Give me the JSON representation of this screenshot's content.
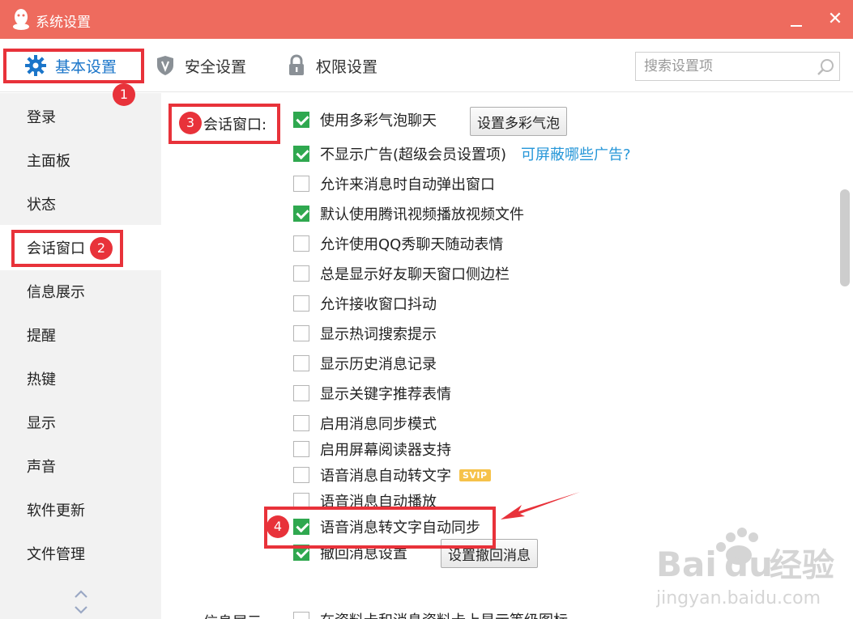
{
  "window": {
    "title": "系统设置"
  },
  "tabs": [
    {
      "label": "基本设置",
      "icon": "gear-icon"
    },
    {
      "label": "安全设置",
      "icon": "shield-icon"
    },
    {
      "label": "权限设置",
      "icon": "lock-icon"
    }
  ],
  "search": {
    "placeholder": "搜索设置项",
    "value": ""
  },
  "sidebar": {
    "items": [
      {
        "label": "登录"
      },
      {
        "label": "主面板"
      },
      {
        "label": "状态"
      },
      {
        "label": "会话窗口"
      },
      {
        "label": "信息展示"
      },
      {
        "label": "提醒"
      },
      {
        "label": "热键"
      },
      {
        "label": "显示"
      },
      {
        "label": "声音"
      },
      {
        "label": "软件更新"
      },
      {
        "label": "文件管理"
      }
    ],
    "active": "会话窗口"
  },
  "main": {
    "section_label": "会话窗口:",
    "options": [
      {
        "label": "使用多彩气泡聊天",
        "checked": true
      },
      {
        "label": "不显示广告(超级会员设置项)",
        "checked": true
      },
      {
        "label": "允许来消息时自动弹出窗口",
        "checked": false
      },
      {
        "label": "默认使用腾讯视频播放视频文件",
        "checked": true
      },
      {
        "label": "允许使用QQ秀聊天随动表情",
        "checked": false
      },
      {
        "label": "总是显示好友聊天窗口侧边栏",
        "checked": false
      },
      {
        "label": "允许接收窗口抖动",
        "checked": false
      },
      {
        "label": "显示热词搜索提示",
        "checked": false
      },
      {
        "label": "显示历史消息记录",
        "checked": false
      },
      {
        "label": "显示关键字推荐表情",
        "checked": false
      },
      {
        "label": "启用消息同步模式",
        "checked": false
      },
      {
        "label": "启用屏幕阅读器支持",
        "checked": false
      },
      {
        "label": "语音消息自动转文字",
        "checked": false
      },
      {
        "label": "语音消息自动播放",
        "checked": false
      },
      {
        "label": "语音消息转文字自动同步",
        "checked": true
      },
      {
        "label": "撤回消息设置",
        "checked": true
      }
    ],
    "buttons": {
      "bubble": "设置多彩气泡",
      "recall": "设置撤回消息"
    },
    "ad_link": "可屏蔽哪些广告?",
    "svip_badge": "SVIP",
    "next_section_label": "信息展示:",
    "next_option": "在资料卡和消息资料卡上显示等级图标"
  },
  "annotations": [
    "1",
    "2",
    "3",
    "4"
  ],
  "watermark": {
    "brand": "Bai du 经验",
    "url": "jingyan.baidu.com"
  },
  "colors": {
    "titlebar": "#ee6b5e",
    "accent": "#1a75c9",
    "check": "#2fa84f",
    "annotation": "#e8323a",
    "link": "#2596d8"
  }
}
